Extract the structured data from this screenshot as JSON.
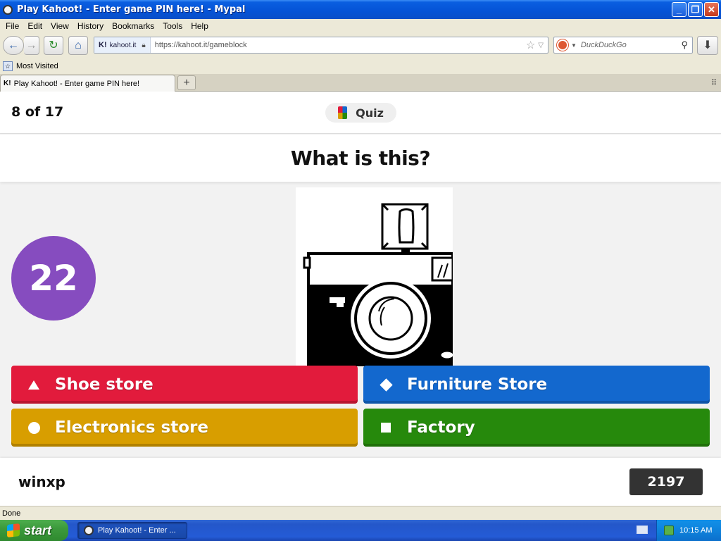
{
  "window": {
    "title": "Play Kahoot! - Enter game PIN here! - Mypal",
    "min_label": "_",
    "max_label": "❐",
    "close_label": "✕"
  },
  "menu": {
    "items": [
      "File",
      "Edit",
      "View",
      "History",
      "Bookmarks",
      "Tools",
      "Help"
    ]
  },
  "nav": {
    "back_icon": "←",
    "forward_icon": "→",
    "reload_icon": "↻",
    "home_icon": "⌂",
    "site_logo": "K!",
    "site_name": "kahoot.it",
    "url": "https://kahoot.it/gameblock",
    "search_placeholder": "DuckDuckGo",
    "download_icon": "⬇"
  },
  "bookmarks": {
    "most_visited": "Most Visited"
  },
  "tabs": {
    "active_favicon": "K!",
    "active_label": "Play Kahoot! - Enter game PIN here!",
    "new_tab_label": "+"
  },
  "game": {
    "progress": "8 of 17",
    "mode_label": "Quiz",
    "question": "What is this?",
    "timer": "22",
    "answers": [
      {
        "label": "Shoe store",
        "shape": "triangle",
        "color": "#e21b3c"
      },
      {
        "label": "Furniture Store",
        "shape": "diamond",
        "color": "#1368ce"
      },
      {
        "label": "Electronics store",
        "shape": "circle",
        "color": "#d89e00"
      },
      {
        "label": "Factory",
        "shape": "square",
        "color": "#26890c"
      }
    ],
    "player_name": "winxp",
    "score": "2197",
    "timer_color": "#864cbf"
  },
  "status": {
    "text": "Done"
  },
  "taskbar": {
    "start_label": "start",
    "task_label": "Play Kahoot! - Enter ...",
    "clock": "10:15 AM"
  }
}
